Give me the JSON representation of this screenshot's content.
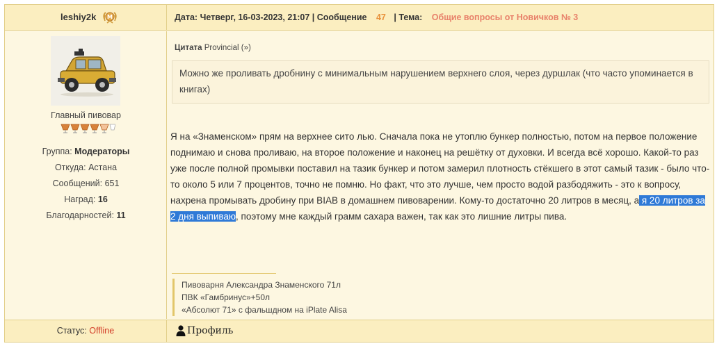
{
  "header": {
    "username": "leshiy2k",
    "date_label": "Дата:",
    "date_value": "Четверг, 16-03-2023, 21:07",
    "post_label": "| Сообщение",
    "post_number": "47",
    "topic_label": "| Тема:",
    "topic_title": "Общие вопросы от Новичков № 3"
  },
  "user": {
    "rank": "Главный пивовар",
    "group_label": "Группа:",
    "group_value": "Модераторы",
    "from_label": "Откуда:",
    "from_value": "Астана",
    "posts_label": "Сообщений:",
    "posts_value": "651",
    "awards_label": "Наград:",
    "awards_value": "16",
    "thanks_label": "Благодарностей:",
    "thanks_value": "11",
    "status_label": "Статус:",
    "status_value": "Offline",
    "status_color": "#d23b26"
  },
  "quote": {
    "label": "Цитата",
    "author": "Provincial",
    "link": "(»)",
    "text": "Можно же проливать дробнину с минимальным нарушением верхнего слоя, через дуршлак (что часто упоминается в книгах)"
  },
  "message": {
    "before_selection": "Я на «Знаменском» прям на верхнее сито лью. Сначала пока не утоплю бункер полностью, потом на первое положение поднимаю и снова проливаю, на второе положение и наконец на решётку от духовки. И всегда всё хорошо. Какой-то раз уже после полной промывки поставил на тазик бункер и потом замерил плотность стёкшего в этот самый тазик - было что-то около 5 или 7 процентов, точно не помню. Но факт, что это лучше, чем просто водой разбодяжить - это к вопросу, нахрена промывать дробину при BIAB в домашнем пивоварении. Кому-то достаточно 20 литров в месяц, а",
    "selected": " я 20 литров за 2 дня выпиваю",
    "after_selection": ", поэтому мне каждый грамм сахара важен, так как это лишние литры пива.",
    "selection_color": "#2f7ad7"
  },
  "signature": {
    "line1": "Пивоварня Александра Знаменского 71л",
    "line2": "ПВК «Гамбринус»+50л",
    "line3": "«Абсолют 71» с фальшдном на iPlate Alisa"
  },
  "footer": {
    "profile_label": "Профиль",
    "profile_icon": "user-icon"
  },
  "colors": {
    "header_bg": "#fbeec0",
    "post_bg": "#fdf7e1",
    "border": "#e2cf8a",
    "post_number": "#e8913a",
    "topic": "#e8816a"
  }
}
